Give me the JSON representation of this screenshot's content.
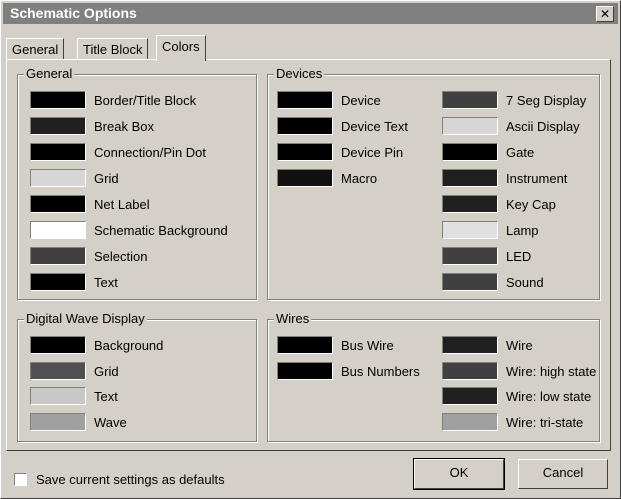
{
  "window": {
    "title": "Schematic Options",
    "close_glyph": "✕"
  },
  "tabs": [
    {
      "label": "General",
      "active": false
    },
    {
      "label": "Title Block",
      "active": false
    },
    {
      "label": "Colors",
      "active": true
    }
  ],
  "groups": {
    "general": {
      "title": "General",
      "items": [
        {
          "label": "Border/Title Block",
          "color": "#000000"
        },
        {
          "label": "Break Box",
          "color": "#202020"
        },
        {
          "label": "Connection/Pin Dot",
          "color": "#000000"
        },
        {
          "label": "Grid",
          "color": "#d6d6d6"
        },
        {
          "label": "Net Label",
          "color": "#000000"
        },
        {
          "label": "Schematic Background",
          "color": "#ffffff"
        },
        {
          "label": "Selection",
          "color": "#404040"
        },
        {
          "label": "Text",
          "color": "#000000"
        }
      ]
    },
    "devices": {
      "title": "Devices",
      "left_items": [
        {
          "label": "Device",
          "color": "#000000"
        },
        {
          "label": "Device Text",
          "color": "#000000"
        },
        {
          "label": "Device Pin",
          "color": "#000000"
        },
        {
          "label": "Macro",
          "color": "#101010"
        }
      ],
      "right_items": [
        {
          "label": "7 Seg Display",
          "color": "#404040"
        },
        {
          "label": "Ascii Display",
          "color": "#d6d6d6"
        },
        {
          "label": "Gate",
          "color": "#000000"
        },
        {
          "label": "Instrument",
          "color": "#202020"
        },
        {
          "label": "Key Cap",
          "color": "#202020"
        },
        {
          "label": "Lamp",
          "color": "#e0e0e0"
        },
        {
          "label": "LED",
          "color": "#404040"
        },
        {
          "label": "Sound",
          "color": "#404040"
        }
      ]
    },
    "digital_wave": {
      "title": "Digital Wave Display",
      "items": [
        {
          "label": "Background",
          "color": "#000000"
        },
        {
          "label": "Grid",
          "color": "#505050"
        },
        {
          "label": "Text",
          "color": "#c8c8c8"
        },
        {
          "label": "Wave",
          "color": "#a0a0a0"
        }
      ]
    },
    "wires": {
      "title": "Wires",
      "left_items": [
        {
          "label": "Bus Wire",
          "color": "#000000"
        },
        {
          "label": "Bus Numbers",
          "color": "#000000"
        }
      ],
      "right_items": [
        {
          "label": "Wire",
          "color": "#202020"
        },
        {
          "label": "Wire: high state",
          "color": "#404040"
        },
        {
          "label": "Wire: low state",
          "color": "#202020"
        },
        {
          "label": "Wire: tri-state",
          "color": "#a0a0a0"
        }
      ]
    }
  },
  "footer": {
    "checkbox_label": "Save current settings as defaults",
    "checked": false,
    "ok_label": "OK",
    "cancel_label": "Cancel"
  }
}
